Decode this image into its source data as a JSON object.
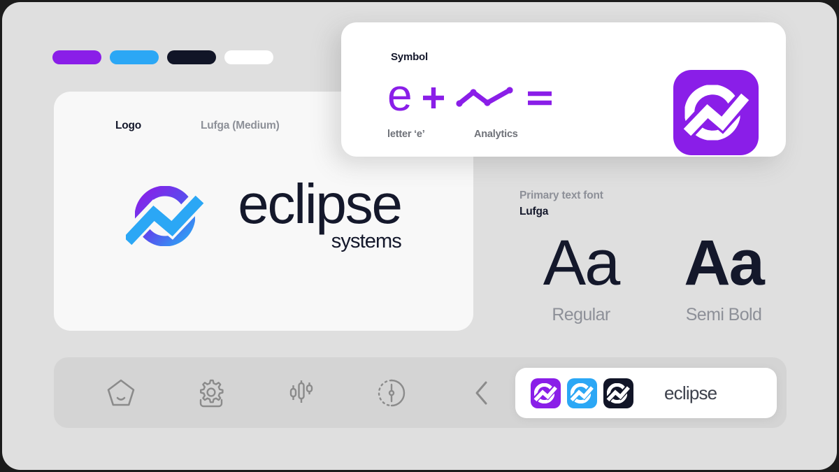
{
  "theme": {
    "page_background": "#1b1b1b",
    "panel_background": "#dfdfdf",
    "card_background": "#f8f8f8",
    "white": "#ffffff",
    "toolbar_background": "#d4d4d4",
    "brand_purple": "#8a1ee8",
    "brand_blue": "#2ba7f5",
    "brand_dark": "#111527",
    "muted_text": "#8d9098",
    "dark_text": "#14182b"
  },
  "palette": {
    "name": "brand-color-swatches",
    "swatches": [
      {
        "name": "purple",
        "hex": "#8a1ee8"
      },
      {
        "name": "blue",
        "hex": "#2ba7f5"
      },
      {
        "name": "dark-navy",
        "hex": "#111527"
      },
      {
        "name": "white",
        "hex": "#ffffff"
      }
    ]
  },
  "logo_card": {
    "label": "Logo",
    "font_label": "Lufga (Medium)",
    "wordmark": "eclipse",
    "subword": "systems",
    "mark_gradient_from": "#8a1ee8",
    "mark_gradient_to": "#2ba7f5"
  },
  "symbol_card": {
    "title": "Symbol",
    "equation": {
      "term_1": "e",
      "operator_plus": "+",
      "term_2_icon": "analytics-line-icon",
      "operator_equals": "=",
      "result_icon": "eclipse-app-icon"
    },
    "captions": {
      "term_1": "letter ‘e’",
      "term_2": "Analytics"
    },
    "result_background": "#8a1ee8"
  },
  "typography": {
    "kicker": "Primary text font",
    "family": "Lufga",
    "specimens": [
      {
        "sample": "Aa",
        "weight_label": "Regular"
      },
      {
        "sample": "Aa",
        "weight_label": "Semi Bold"
      }
    ]
  },
  "toolbar": {
    "icons": [
      {
        "name": "pentagon-face-icon"
      },
      {
        "name": "gear-icon"
      },
      {
        "name": "candlestick-chart-icon"
      },
      {
        "name": "gauge-timer-icon"
      },
      {
        "name": "chevron-left-icon"
      }
    ]
  },
  "variants_card": {
    "name": "eclipse",
    "app_icons": [
      {
        "name": "app-icon-purple",
        "hex": "#8a1ee8"
      },
      {
        "name": "app-icon-blue",
        "hex": "#2ba7f5"
      },
      {
        "name": "app-icon-dark",
        "hex": "#111527"
      }
    ]
  }
}
